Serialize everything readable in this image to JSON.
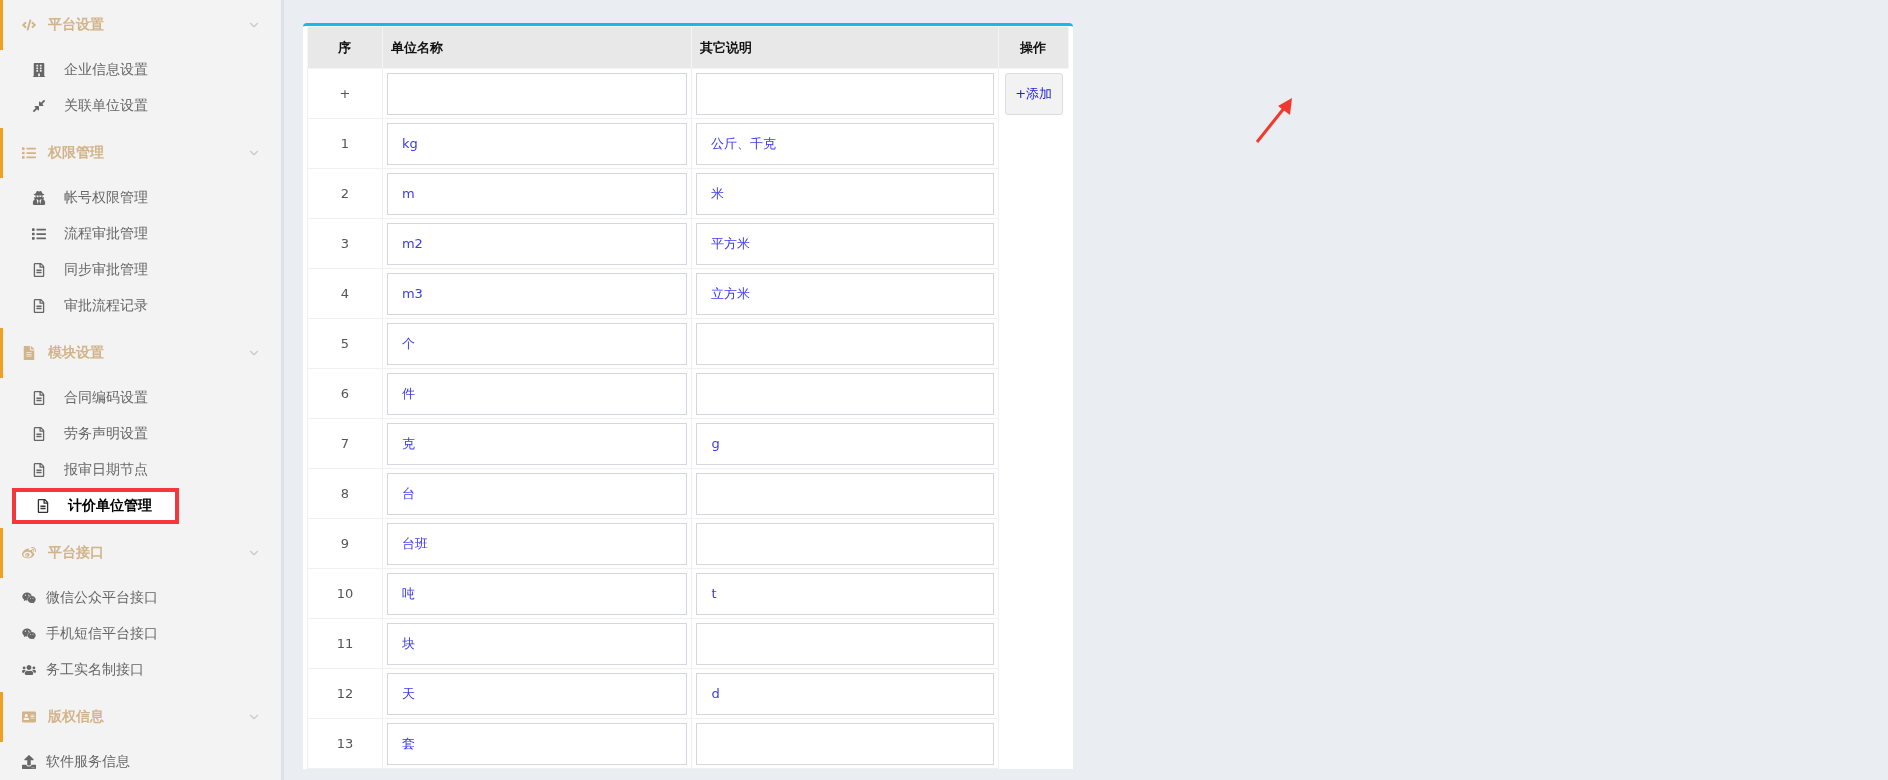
{
  "sidebar": {
    "groups": [
      {
        "title": "平台设置",
        "items": [
          {
            "label": "企业信息设置",
            "selected": false
          },
          {
            "label": "关联单位设置",
            "selected": false
          }
        ]
      },
      {
        "title": "权限管理",
        "items": [
          {
            "label": "帐号权限管理",
            "selected": false
          },
          {
            "label": "流程审批管理",
            "selected": false
          },
          {
            "label": "同步审批管理",
            "selected": false
          },
          {
            "label": "审批流程记录",
            "selected": false
          }
        ]
      },
      {
        "title": "模块设置",
        "items": [
          {
            "label": "合同编码设置",
            "selected": false
          },
          {
            "label": "劳务声明设置",
            "selected": false
          },
          {
            "label": "报审日期节点",
            "selected": false
          },
          {
            "label": "计价单位管理",
            "selected": true
          }
        ]
      },
      {
        "title": "平台接口",
        "items": [
          {
            "label": "微信公众平台接口",
            "selected": false
          },
          {
            "label": "手机短信平台接口",
            "selected": false
          },
          {
            "label": "务工实名制接口",
            "selected": false
          }
        ]
      },
      {
        "title": "版权信息",
        "items": [
          {
            "label": "软件服务信息",
            "selected": false
          }
        ]
      }
    ]
  },
  "table": {
    "columns": [
      "序",
      "单位名称",
      "其它说明",
      "操作"
    ],
    "new_row": {
      "seq": "+",
      "button": "+添加"
    },
    "rows": [
      {
        "seq": "1",
        "name": "kg",
        "note": "公斤、千克"
      },
      {
        "seq": "2",
        "name": "m",
        "note": "米"
      },
      {
        "seq": "3",
        "name": "m2",
        "note": "平方米"
      },
      {
        "seq": "4",
        "name": "m3",
        "note": "立方米"
      },
      {
        "seq": "5",
        "name": "个",
        "note": ""
      },
      {
        "seq": "6",
        "name": "件",
        "note": ""
      },
      {
        "seq": "7",
        "name": "克",
        "note": "g"
      },
      {
        "seq": "8",
        "name": "台",
        "note": ""
      },
      {
        "seq": "9",
        "name": "台班",
        "note": ""
      },
      {
        "seq": "10",
        "name": "吨",
        "note": "t"
      },
      {
        "seq": "11",
        "name": "块",
        "note": ""
      },
      {
        "seq": "12",
        "name": "天",
        "note": "d"
      },
      {
        "seq": "13",
        "name": "套",
        "note": ""
      }
    ]
  }
}
